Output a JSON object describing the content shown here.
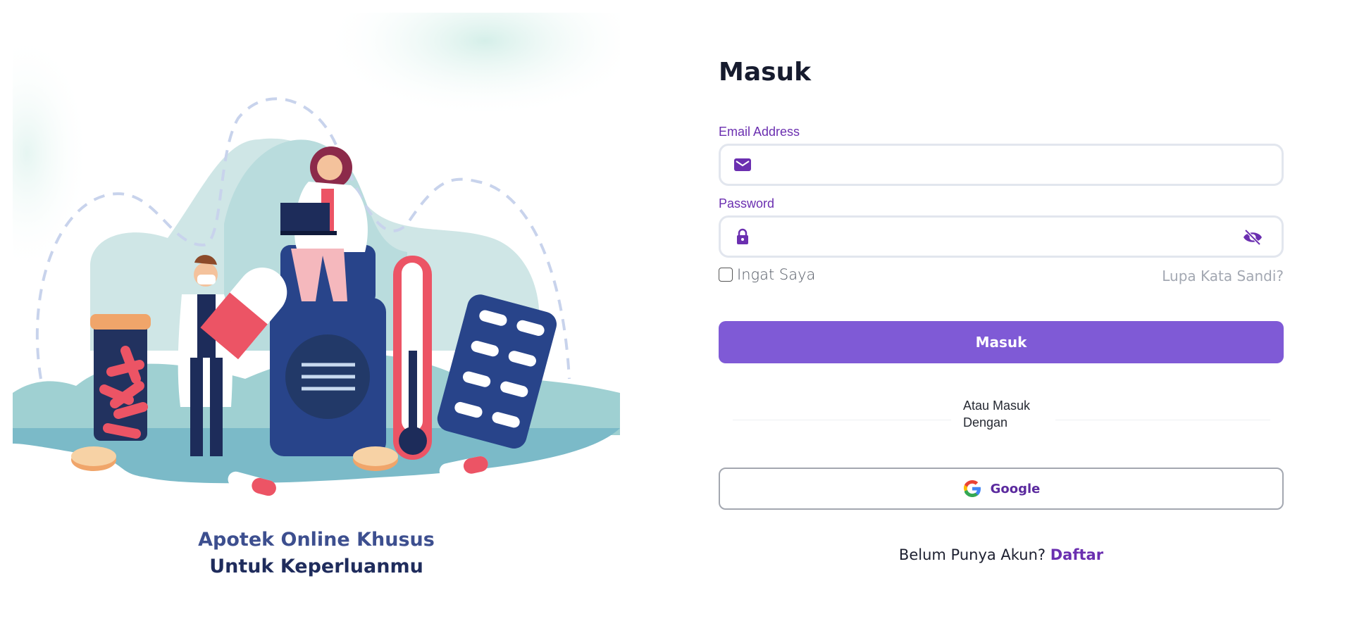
{
  "hero": {
    "tagline_line1": "Apotek Online Khusus",
    "tagline_line2": "Untuk Keperluanmu"
  },
  "form": {
    "title": "Masuk",
    "email_label": "Email Address",
    "email_value": "",
    "password_label": "Password",
    "password_value": "",
    "remember_label": "Ingat Saya",
    "remember_checked": false,
    "forgot_label": "Lupa Kata Sandi?",
    "submit_label": "Masuk",
    "divider_text": "Atau Masuk Dengan",
    "google_label": "Google",
    "signup_prompt": "Belum Punya Akun?",
    "signup_link": "Daftar"
  },
  "icons": {
    "email": "mail-icon",
    "password": "lock-icon",
    "toggle_visibility": "eye-off-icon",
    "google": "google-logo-icon"
  },
  "colors": {
    "accent": "#6b2fb0",
    "primary_button": "#7f5ad6",
    "hero_text_1": "#3d4f8f",
    "hero_text_2": "#1f2c5c"
  }
}
